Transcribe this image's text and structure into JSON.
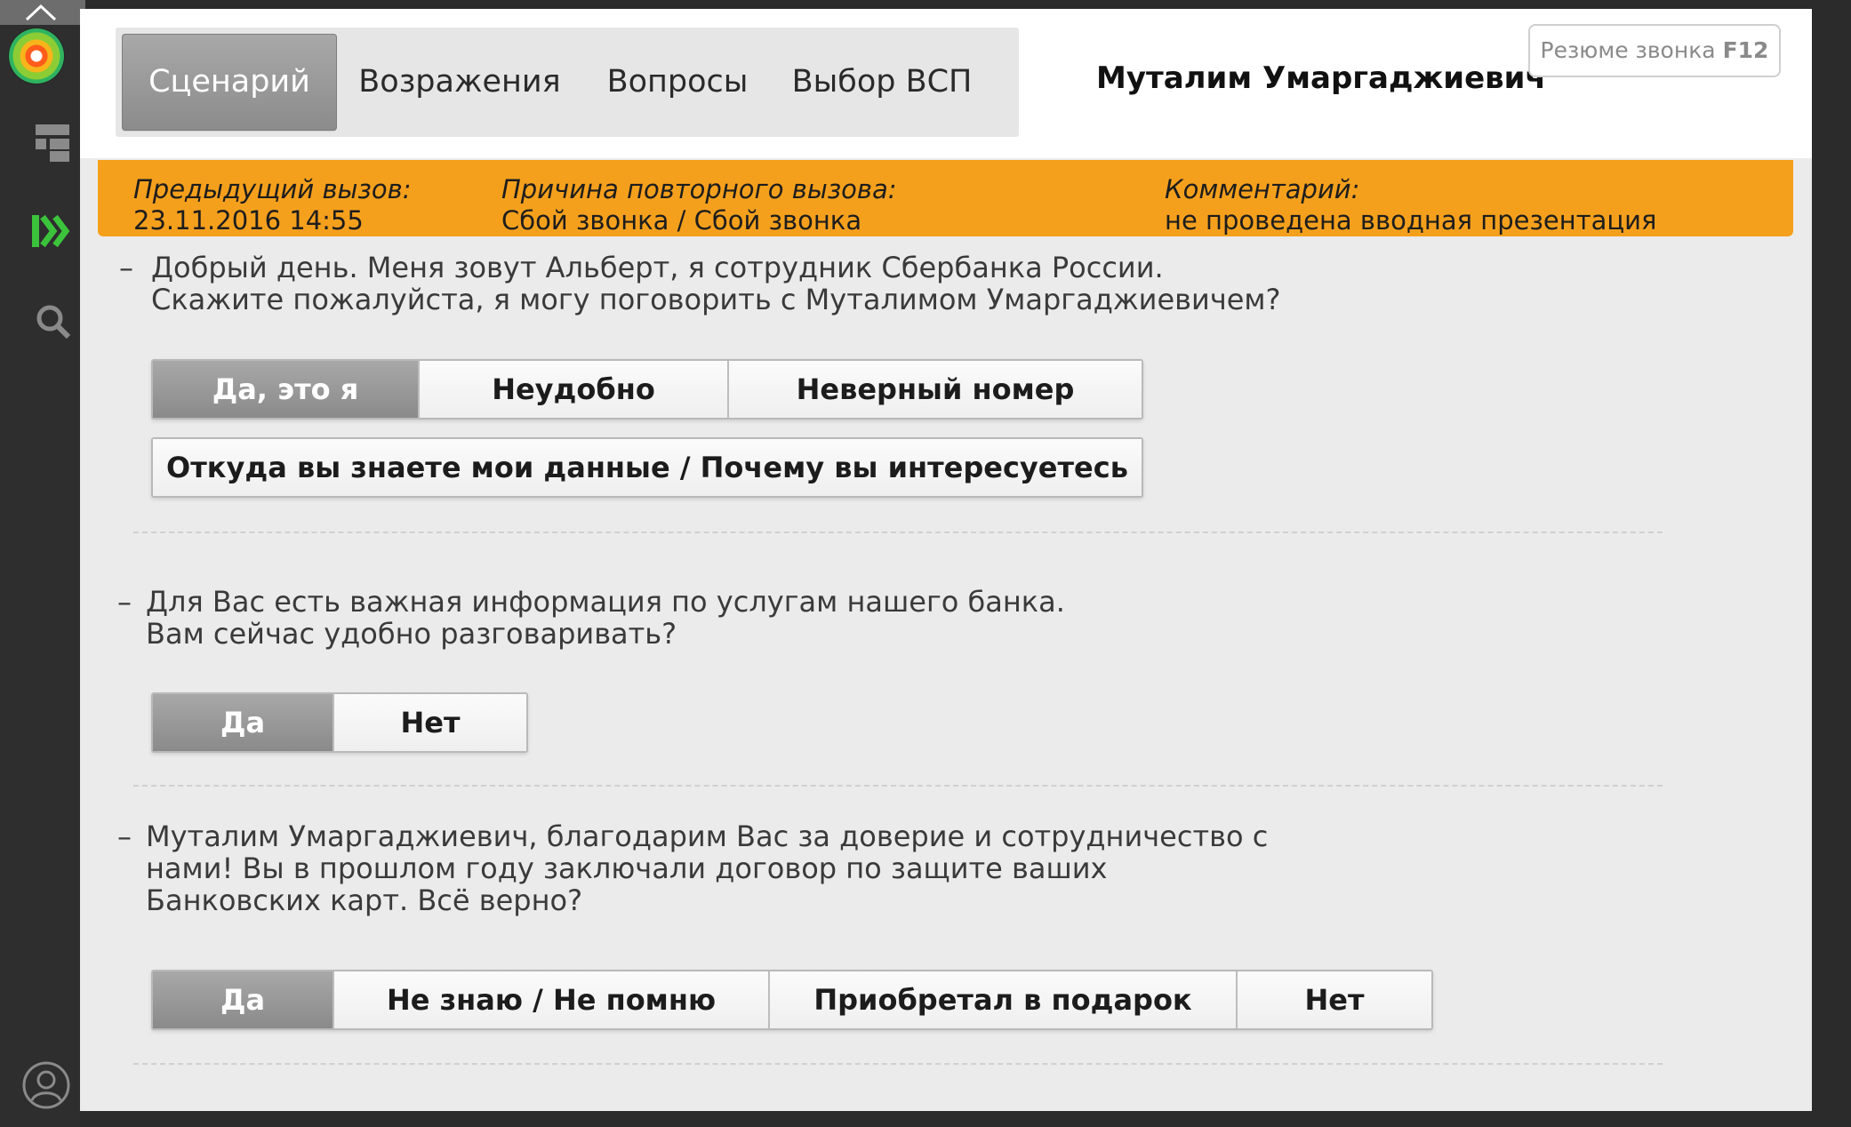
{
  "sidebar": {
    "icons": [
      "chevron-up-icon",
      "app-logo-icon",
      "dashboard-icon",
      "script-arrows-icon",
      "search-icon",
      "user-profile-icon"
    ],
    "accent": "#3cc33c"
  },
  "header": {
    "tabs": [
      {
        "label": "Сценарий"
      },
      {
        "label": "Возражения"
      },
      {
        "label": "Вопросы"
      },
      {
        "label": "Выбор ВСП"
      }
    ],
    "client_name": "Муталим Умаргаджиевич",
    "summary_label": "Резюме звонка",
    "summary_key": "F12"
  },
  "info_bar": {
    "color": "#f5a01d",
    "prev_call_label": "Предыдущий вызов:",
    "prev_call_value": "23.11.2016 14:55",
    "reason_label": "Причина повторного вызова:",
    "reason_value": "Сбой звонка / Сбой звонка",
    "comment_label": "Комментарий:",
    "comment_value": "не проведена вводная презентация"
  },
  "script": [
    {
      "dash": "–",
      "lines": [
        "Добрый день. Меня зовут Альберт, я сотрудник Сбербанка России.",
        "Скажите пожалуйста, я могу поговорить с Муталимом Умаргаджиевичем?"
      ],
      "answers_row1": [
        "Да, это я",
        "Неудобно",
        "Неверный номер"
      ],
      "answers_row2": [
        "Откуда вы знаете мои данные / Почему вы интересуетесь"
      ]
    },
    {
      "dash": "–",
      "lines": [
        "Для Вас есть важная информация по услугам нашего банка.",
        "Вам сейчас удобно разговаривать?"
      ],
      "answers": [
        "Да",
        "Нет"
      ]
    },
    {
      "dash": "–",
      "lines": [
        "Муталим Умаргаджиевич, благодарим Вас за доверие и сотрудничество с",
        "нами! Вы в прошлом году заключали договор по защите ваших",
        "Банковских карт. Всё верно?"
      ],
      "answers": [
        "Да",
        "Не знаю / Не помню",
        "Приобретал в подарок",
        "Нет"
      ]
    }
  ]
}
